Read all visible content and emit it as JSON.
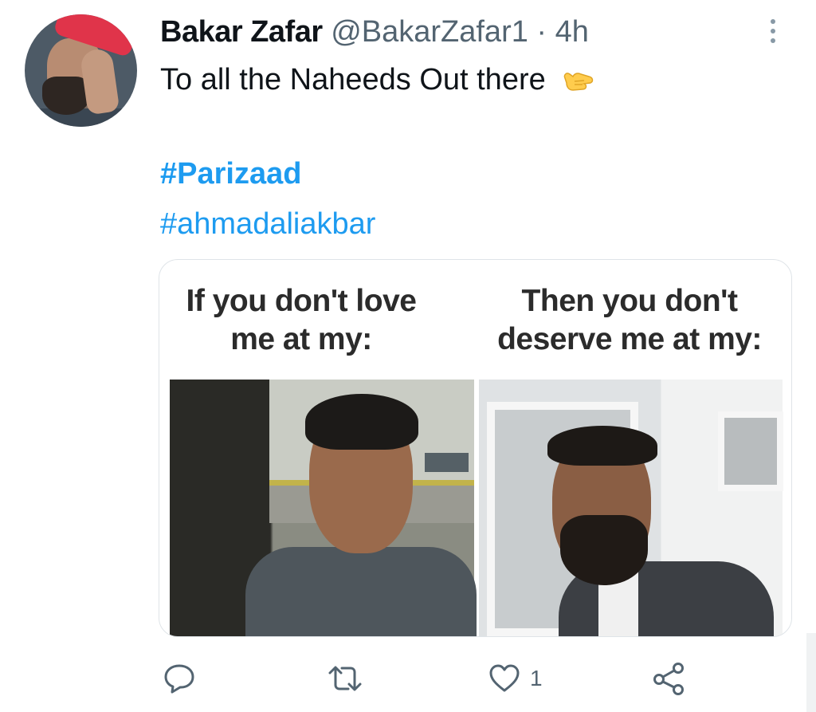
{
  "tweet": {
    "author_name": "Bakar Zafar",
    "handle": "@BakarZafar1",
    "separator": "·",
    "time": "4h",
    "text": "To all the Naheeds Out there",
    "emoji": "call-me-hand-emoji",
    "hashtags": [
      "#Parizaad",
      "#ahmadaliakbar"
    ]
  },
  "media": {
    "caption_left": "If you don't love me at my:",
    "caption_right": "Then you don't deserve me at my:"
  },
  "actions": {
    "reply_icon": "reply-icon",
    "retweet_icon": "retweet-icon",
    "like_icon": "heart-icon",
    "like_count": "1",
    "share_icon": "share-icon"
  },
  "colors": {
    "link": "#1d9bf0",
    "text": "#0f1419",
    "secondary": "#536471"
  }
}
